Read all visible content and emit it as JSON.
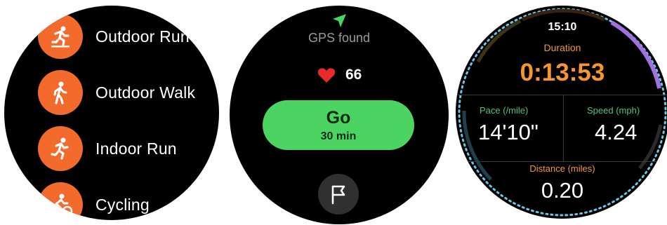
{
  "workouts": {
    "items": [
      {
        "label": "Outdoor Run",
        "icon": "outdoor-run-icon"
      },
      {
        "label": "Outdoor Walk",
        "icon": "walk-icon"
      },
      {
        "label": "Indoor Run",
        "icon": "indoor-run-icon"
      },
      {
        "label": "Cycling",
        "icon": "cycling-icon"
      }
    ]
  },
  "start": {
    "gps_status": "GPS found",
    "heart_rate": "66",
    "go_label": "Go",
    "go_sub": "30 min"
  },
  "active": {
    "time": "15:10",
    "duration_label": "Duration",
    "duration": "0:13:53",
    "pace_label": "Pace (/mile)",
    "pace": "14'10\"",
    "speed_label": "Speed (mph)",
    "speed": "4.24",
    "distance_label": "Distance (miles)",
    "distance": "0.20"
  },
  "colors": {
    "accent_orange": "#f26a2c",
    "go_green": "#4cd463",
    "heart_red": "#e82a2a",
    "label_green": "#4fc37a",
    "duration_orange": "#f7962c"
  }
}
